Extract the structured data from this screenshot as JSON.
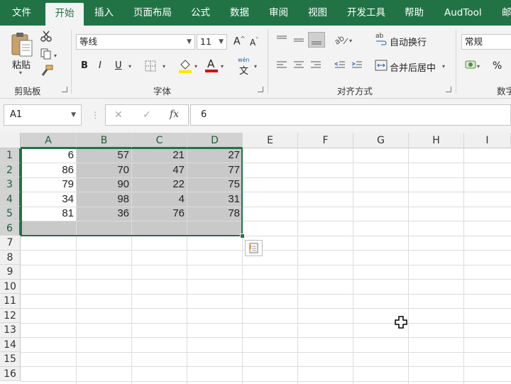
{
  "tabs": [
    {
      "label": "文件",
      "active": false
    },
    {
      "label": "开始",
      "active": true
    },
    {
      "label": "插入",
      "active": false
    },
    {
      "label": "页面布局",
      "active": false
    },
    {
      "label": "公式",
      "active": false
    },
    {
      "label": "数据",
      "active": false
    },
    {
      "label": "审阅",
      "active": false
    },
    {
      "label": "视图",
      "active": false
    },
    {
      "label": "开发工具",
      "active": false
    },
    {
      "label": "帮助",
      "active": false
    },
    {
      "label": "AudTool",
      "active": false
    },
    {
      "label": "邮",
      "active": false
    }
  ],
  "ribbon": {
    "clipboard": {
      "paste_label": "粘贴",
      "group_label": "剪贴板"
    },
    "font": {
      "font_name": "等线",
      "font_size": "11",
      "bold": "B",
      "italic": "I",
      "underline": "U",
      "grow": "A",
      "shrink": "A",
      "font_color_letter": "A",
      "wen_top": "wén",
      "wen_char": "文",
      "group_label": "字体"
    },
    "alignment": {
      "wrap_text": "自动换行",
      "merge_center": "合并后居中",
      "group_label": "对齐方式"
    },
    "number": {
      "format": "常规",
      "percent": "%",
      "group_label": "数字"
    }
  },
  "accent": "#217346",
  "formula_bar": {
    "name_box": "A1",
    "cancel": "✕",
    "enter": "✓",
    "fx": "fx",
    "content": "6"
  },
  "columns": [
    "A",
    "B",
    "C",
    "D",
    "E",
    "F",
    "G",
    "H",
    "I"
  ],
  "rows": [
    "1",
    "2",
    "3",
    "4",
    "5",
    "6",
    "7",
    "8",
    "9",
    "10",
    "11",
    "12",
    "13",
    "14",
    "15",
    "16"
  ],
  "cells": [
    [
      "6",
      "57",
      "21",
      "27"
    ],
    [
      "86",
      "70",
      "47",
      "77"
    ],
    [
      "79",
      "90",
      "22",
      "75"
    ],
    [
      "34",
      "98",
      "4",
      "31"
    ],
    [
      "81",
      "36",
      "76",
      "78"
    ]
  ],
  "selection": "A1:D6"
}
